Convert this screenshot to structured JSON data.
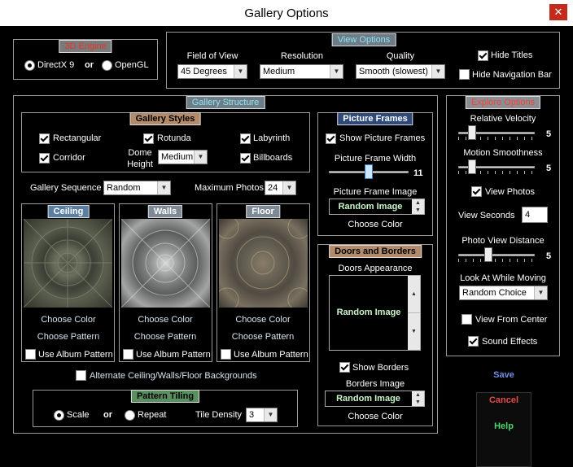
{
  "window": {
    "title": "Gallery Options",
    "close_glyph": "✕"
  },
  "engine": {
    "legend": "3D Engine",
    "opt1": "DirectX 9",
    "or": "or",
    "opt2": "OpenGL"
  },
  "view": {
    "legend": "View Options",
    "fov_label": "Field of View",
    "fov_value": "45 Degrees",
    "res_label": "Resolution",
    "res_value": "Medium",
    "quality_label": "Quality",
    "quality_value": "Smooth (slowest)",
    "hide_titles": "Hide Titles",
    "hide_nav": "Hide Navigation Bar"
  },
  "structure": {
    "legend": "Gallery Structure",
    "styles_legend": "Gallery Styles",
    "rect": "Rectangular",
    "rotunda": "Rotunda",
    "labyrinth": "Labyrinth",
    "corridor": "Corridor",
    "dome1": "Dome",
    "dome2": "Height",
    "dome_value": "Medium",
    "billboards": "Billboards",
    "seq_label": "Gallery Sequence",
    "seq_value": "Random",
    "max_label": "Maximum Photos",
    "max_value": "24",
    "ceiling": "Ceiling",
    "walls": "Walls",
    "floor": "Floor",
    "choose_color": "Choose Color",
    "choose_pattern": "Choose Pattern",
    "use_album": "Use Album Pattern",
    "alternate": "Alternate Ceiling/Walls/Floor Backgrounds",
    "tiling_legend": "Pattern Tiling",
    "scale": "Scale",
    "or": "or",
    "repeat": "Repeat",
    "density_label": "Tile Density",
    "density_value": "3"
  },
  "frames": {
    "legend": "Picture Frames",
    "show": "Show Picture Frames",
    "width_label": "Picture Frame Width",
    "width_value": "11",
    "image_label": "Picture Frame Image",
    "image_value": "Random Image",
    "choose_color": "Choose Color"
  },
  "doors": {
    "legend": "Doors and Borders",
    "appearance": "Doors Appearance",
    "value": "Random Image",
    "show_borders": "Show Borders",
    "borders_image": "Borders Image",
    "borders_value": "Random Image",
    "choose_color": "Choose Color"
  },
  "explore": {
    "legend": "Explore Options",
    "velocity_label": "Relative Velocity",
    "velocity_value": "5",
    "motion_label": "Motion Smoothness",
    "motion_value": "5",
    "view_photos": "View Photos",
    "seconds_label": "View Seconds",
    "seconds_value": "4",
    "distance_label": "Photo View Distance",
    "distance_value": "5",
    "look_label": "Look At While Moving",
    "look_value": "Random Choice",
    "from_center": "View From Center",
    "sound": "Sound Effects"
  },
  "actions": {
    "save": "Save",
    "cancel": "Cancel",
    "help": "Help"
  },
  "colors": {
    "save": "#6f8fe6",
    "cancel": "#e84a4a",
    "help": "#4fd66a"
  },
  "icons": {
    "close": "close-icon",
    "dropdown": "chevron-down-icon",
    "spin_up": "up-arrow-icon",
    "spin_down": "down-arrow-icon"
  }
}
